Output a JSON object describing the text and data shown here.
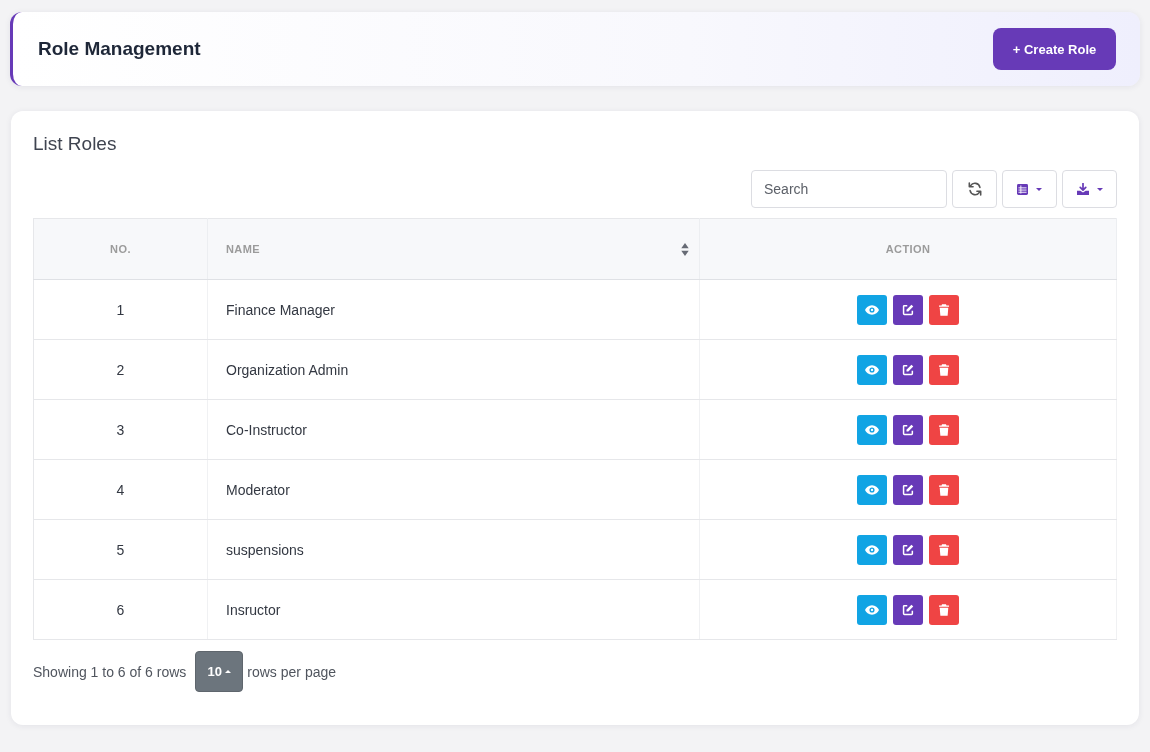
{
  "header": {
    "title": "Role Management",
    "create_button": "+ Create Role"
  },
  "roles_card": {
    "title": "List Roles",
    "search": {
      "placeholder": "Search"
    }
  },
  "table": {
    "columns": [
      {
        "label": "NO.",
        "sortable": false
      },
      {
        "label": "NAME",
        "sortable": true
      },
      {
        "label": "ACTION",
        "sortable": false
      }
    ],
    "row_actions": [
      {
        "kind": "view"
      },
      {
        "kind": "edit"
      },
      {
        "kind": "delete"
      }
    ],
    "rows": [
      {
        "no": "1",
        "name": "Finance Manager"
      },
      {
        "no": "2",
        "name": "Organization Admin"
      },
      {
        "no": "3",
        "name": "Co-Instructor"
      },
      {
        "no": "4",
        "name": "Moderator"
      },
      {
        "no": "5",
        "name": "suspensions"
      },
      {
        "no": "6",
        "name": "Insructor"
      }
    ]
  },
  "pagination": {
    "summary": "Showing 1 to 6 of 6 rows",
    "page_size": "10",
    "page_size_suffix": "rows per page"
  }
}
